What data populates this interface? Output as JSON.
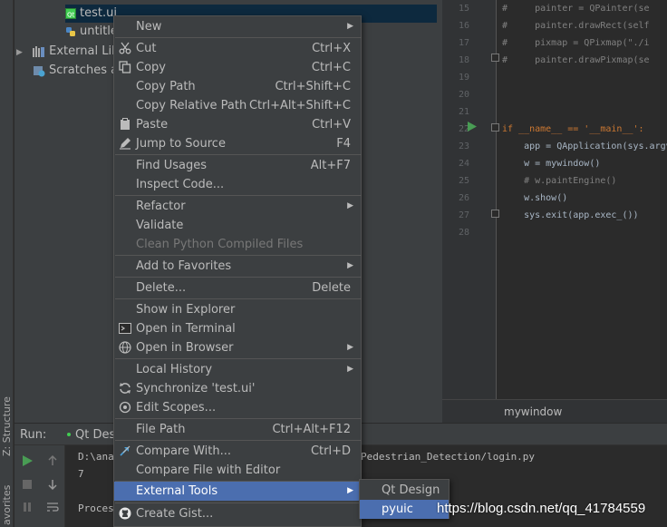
{
  "left_strip": {
    "structure_label": "Z: Structure",
    "favorites_label": "avorites"
  },
  "project_tree": [
    {
      "label": "test.ui",
      "icon": "qt-ui-file-icon"
    },
    {
      "label": "untitle",
      "icon": "python-file-icon"
    },
    {
      "label": "External Libr",
      "icon": "libraries-icon"
    },
    {
      "label": "Scratches ar",
      "icon": "scratches-icon"
    }
  ],
  "editor": {
    "line_numbers": [
      "15",
      "16",
      "17",
      "18",
      "19",
      "20",
      "21",
      "22",
      "23",
      "24",
      "25",
      "26",
      "27",
      "28"
    ],
    "code_lines": [
      "#     painter = QPainter(se",
      "#     painter.drawRect(self",
      "#     pixmap = QPixmap(\"./i",
      "#     painter.drawPixmap(se",
      "",
      "",
      "",
      "if __name__ == '__main__':",
      "    app = QApplication(sys.argv",
      "    w = mywindow()",
      "    # w.paintEngine()",
      "    w.show()",
      "    sys.exit(app.exec_())",
      ""
    ],
    "breadcrumb": "mywindow"
  },
  "run_panel": {
    "label": "Run:",
    "tab": "Qt Desig",
    "console_lines": [
      "D:\\anac",
      "7",
      "Proces"
    ],
    "console_path_tail": "Pedestrian_Detection/login.py"
  },
  "context_menu": {
    "items": [
      {
        "label": "New",
        "submenu": true
      },
      {
        "label": "Cut",
        "shortcut": "Ctrl+X",
        "icon": "cut-icon"
      },
      {
        "label": "Copy",
        "shortcut": "Ctrl+C",
        "icon": "copy-icon"
      },
      {
        "label": "Copy Path",
        "shortcut": "Ctrl+Shift+C"
      },
      {
        "label": "Copy Relative Path",
        "shortcut": "Ctrl+Alt+Shift+C"
      },
      {
        "label": "Paste",
        "shortcut": "Ctrl+V",
        "icon": "paste-icon"
      },
      {
        "label": "Jump to Source",
        "shortcut": "F4",
        "icon": "edit-pencil-icon"
      },
      {
        "label": "Find Usages",
        "shortcut": "Alt+F7"
      },
      {
        "label": "Inspect Code..."
      },
      {
        "label": "Refactor",
        "submenu": true
      },
      {
        "label": "Validate"
      },
      {
        "label": "Clean Python Compiled Files",
        "disabled": true
      },
      {
        "label": "Add to Favorites",
        "submenu": true
      },
      {
        "label": "Delete...",
        "shortcut": "Delete"
      },
      {
        "label": "Show in Explorer"
      },
      {
        "label": "Open in Terminal",
        "icon": "terminal-icon"
      },
      {
        "label": "Open in Browser",
        "submenu": true,
        "icon": "globe-icon"
      },
      {
        "label": "Local History",
        "submenu": true
      },
      {
        "label": "Synchronize 'test.ui'",
        "icon": "sync-icon"
      },
      {
        "label": "Edit Scopes...",
        "icon": "scopes-icon"
      },
      {
        "label": "File Path",
        "shortcut": "Ctrl+Alt+F12"
      },
      {
        "label": "Compare With...",
        "shortcut": "Ctrl+D",
        "icon": "compare-icon"
      },
      {
        "label": "Compare File with Editor"
      },
      {
        "label": "External Tools",
        "submenu": true,
        "active": true
      },
      {
        "label": "Create Gist...",
        "icon": "github-icon"
      }
    ]
  },
  "submenu": {
    "items": [
      {
        "label": "Qt Design"
      },
      {
        "label": "pyuic",
        "active": true
      }
    ]
  },
  "watermark": "https://blog.csdn.net/qq_41784559",
  "colors": {
    "menu_bg": "#3c3f41",
    "highlight": "#4b6eaf",
    "editor_bg": "#2b2b2b",
    "run_green": "#499c54"
  }
}
